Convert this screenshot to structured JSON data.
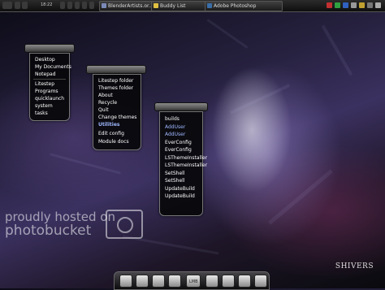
{
  "taskbar": {
    "clock": "18:22",
    "tasks": [
      {
        "label": "BlenderArtists.or..."
      },
      {
        "label": "Buddy List"
      },
      {
        "label": "Adobe Photoshop"
      }
    ]
  },
  "menus": {
    "main": {
      "items": [
        {
          "label": "Desktop"
        },
        {
          "label": "My Documents"
        },
        {
          "label": "Notepad"
        },
        {
          "label": "Litestep"
        },
        {
          "label": "Programs"
        },
        {
          "label": "quicklaunch"
        },
        {
          "label": "system"
        },
        {
          "label": "tasks"
        }
      ]
    },
    "litestep": {
      "items": [
        {
          "label": "Litestep folder"
        },
        {
          "label": "Themes folder"
        },
        {
          "label": "About"
        },
        {
          "label": "Recycle"
        },
        {
          "label": "Quit"
        },
        {
          "label": "Change themes"
        },
        {
          "label": "Utilities"
        },
        {
          "label": "Edit config"
        },
        {
          "label": "Module docs"
        }
      ]
    },
    "utilities": {
      "items": [
        {
          "label": "builds"
        },
        {
          "label": "AddUser"
        },
        {
          "label": "AddUser"
        },
        {
          "label": "EverConfig"
        },
        {
          "label": "EverConfig"
        },
        {
          "label": "LSThemeInstaller"
        },
        {
          "label": "LSThemeInstaller"
        },
        {
          "label": "SetShell"
        },
        {
          "label": "SetShell"
        },
        {
          "label": "UpdateBuild"
        },
        {
          "label": "UpdateBuild"
        }
      ]
    }
  },
  "watermark": {
    "line1": "proudly hosted on",
    "line2": "photobucket"
  },
  "dock": {
    "label": "LMB"
  },
  "branding": {
    "name": "SHIVERS"
  }
}
